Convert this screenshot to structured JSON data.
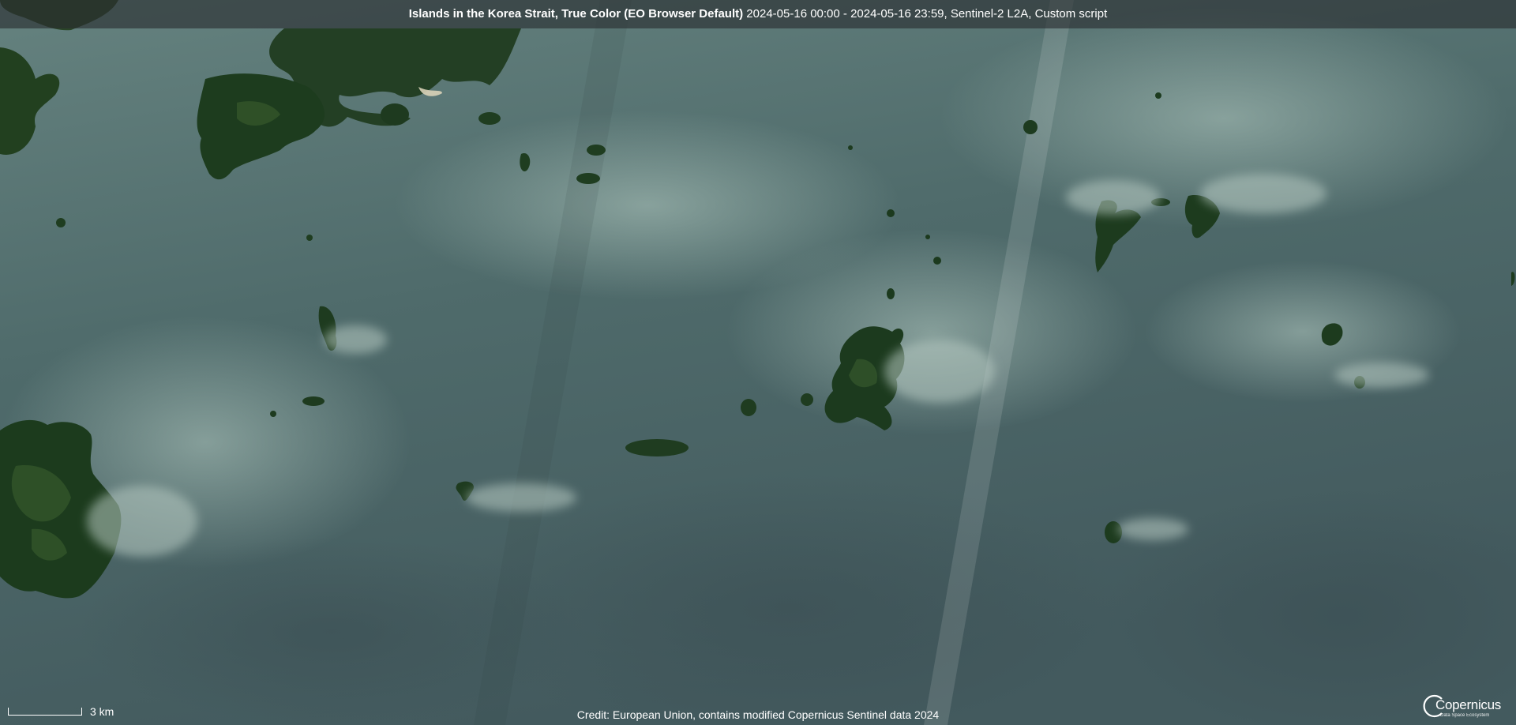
{
  "title": {
    "bold": "Islands in the Korea Strait, True Color (EO Browser Default)",
    "rest": " 2024-05-16 00:00 - 2024-05-16 23:59, Sentinel-2 L2A, Custom script"
  },
  "scale": {
    "label": "3 km"
  },
  "credit": "Credit: European Union, contains modified Copernicus Sentinel data 2024",
  "logo": {
    "name": "Copernicus",
    "subtitle": "Data Space Ecosystem"
  },
  "colors": {
    "sea_light": "#62807e",
    "sea_mid": "#4c6868",
    "sea_dark": "#3f5658",
    "land": "#1f3d22",
    "land_highlight": "#3c5f30",
    "haze": "#a8c0b8"
  }
}
